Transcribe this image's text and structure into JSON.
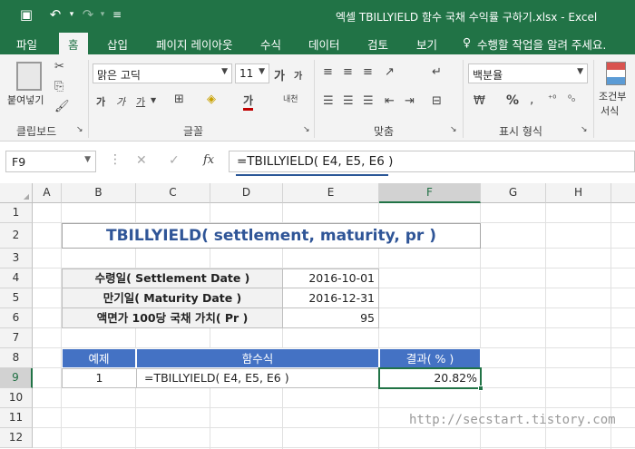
{
  "window": {
    "title": "엑셀 TBILLYIELD 함수 국채 수익률 구하기.xlsx - Excel"
  },
  "tabs": [
    {
      "label": "파일"
    },
    {
      "label": "홈"
    },
    {
      "label": "삽입"
    },
    {
      "label": "페이지 레이아웃"
    },
    {
      "label": "수식"
    },
    {
      "label": "데이터"
    },
    {
      "label": "검토"
    },
    {
      "label": "보기"
    }
  ],
  "tell_me": "수행할 작업을 알려 주세요.",
  "ribbon": {
    "paste_label": "붙여넣기",
    "font_name": "맑은 고딕",
    "font_size": "11",
    "number_format": "백분율",
    "conditional_label_1": "조건부",
    "conditional_label_2": "서식",
    "groups": {
      "clipboard": "클립보드",
      "font": "글꼴",
      "alignment": "맞춤",
      "number": "표시 형식"
    },
    "bold": "가",
    "italic": "가",
    "underline": "가",
    "grow_font": "가",
    "shrink_font": "가",
    "phonetic": "내천",
    "font_color": "가"
  },
  "formula_bar": {
    "name_box": "F9",
    "fx": "fx",
    "formula": "=TBILLYIELD( E4, E5, E6 )"
  },
  "columns": [
    "A",
    "B",
    "C",
    "D",
    "E",
    "F",
    "G",
    "H"
  ],
  "rows": [
    "1",
    "2",
    "3",
    "4",
    "5",
    "6",
    "7",
    "8",
    "9",
    "10",
    "11",
    "12"
  ],
  "sheet": {
    "title": "TBILLYIELD( settlement, maturity, pr )",
    "params": [
      {
        "label": "수령일( Settlement Date )",
        "value": "2016-10-01"
      },
      {
        "label": "만기일( Maturity Date )",
        "value": "2016-12-31"
      },
      {
        "label": "액면가 100당 국채 가치( Pr )",
        "value": "95"
      }
    ],
    "table": {
      "headers": [
        "예제",
        "함수식",
        "결과( % )"
      ],
      "row": {
        "example": "1",
        "formula": "=TBILLYIELD( E4, E5, E6 )",
        "result": "20.82%"
      }
    },
    "header_color": "#4472c4",
    "label_bg": "#f2f2f2",
    "title_color": "#2f5597"
  },
  "watermark": "http://secstart.tistory.com"
}
